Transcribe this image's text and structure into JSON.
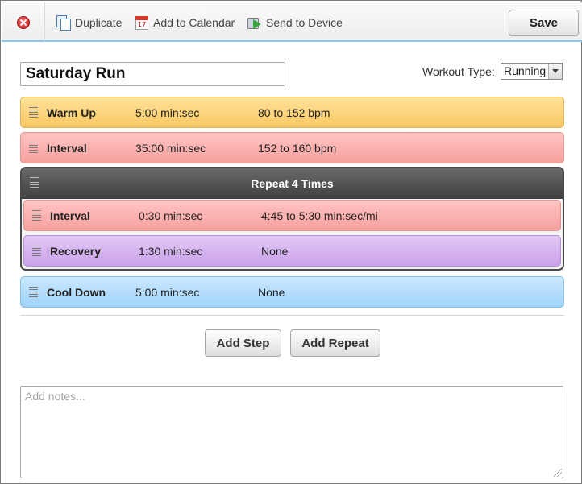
{
  "toolbar": {
    "duplicate_label": "Duplicate",
    "calendar_label": "Add to Calendar",
    "send_label": "Send to Device",
    "save_label": "Save"
  },
  "workout": {
    "name": "Saturday Run",
    "type_label": "Workout Type:",
    "type_value": "Running"
  },
  "steps": {
    "warmup": {
      "name": "Warm Up",
      "duration": "5:00 min:sec",
      "target": "80 to 152 bpm"
    },
    "interval": {
      "name": "Interval",
      "duration": "35:00 min:sec",
      "target": "152 to 160 bpm"
    },
    "repeat": {
      "label": "Repeat 4 Times",
      "interval": {
        "name": "Interval",
        "duration": "0:30 min:sec",
        "target": "4:45 to 5:30 min:sec/mi"
      },
      "recovery": {
        "name": "Recovery",
        "duration": "1:30 min:sec",
        "target": "None"
      }
    },
    "cooldown": {
      "name": "Cool Down",
      "duration": "5:00 min:sec",
      "target": "None"
    }
  },
  "actions": {
    "add_step": "Add Step",
    "add_repeat": "Add Repeat"
  },
  "notes": {
    "placeholder": "Add notes..."
  },
  "colors": {
    "warmup": "#f9c862",
    "interval": "#f6a19e",
    "recovery": "#c9a1ea",
    "cooldown": "#9fd3fb",
    "repeat_header": "#4a4a4a",
    "toolbar_accent": "#8ec7ee"
  },
  "icons": {
    "close": "close-icon",
    "duplicate": "duplicate-icon",
    "calendar": "calendar-icon",
    "send": "send-to-device-icon",
    "drag_handle": "drag-handle-icon"
  }
}
